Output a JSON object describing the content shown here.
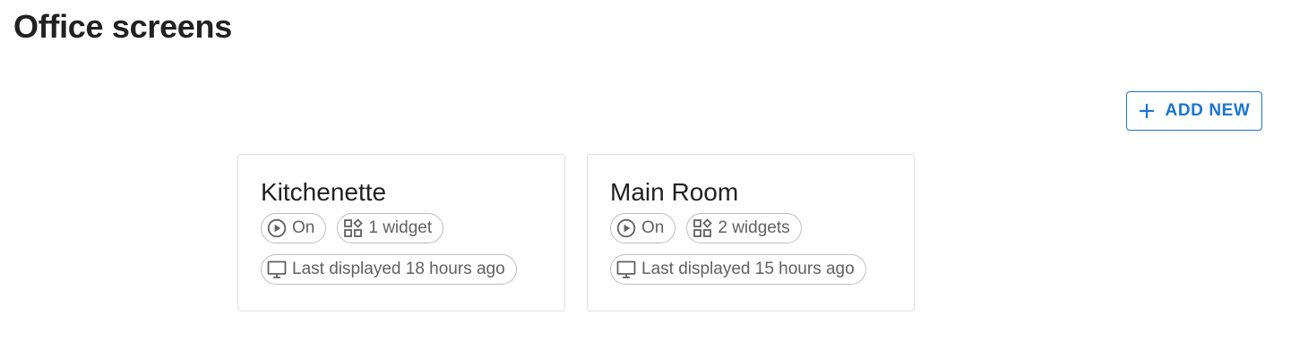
{
  "page": {
    "title": "Office screens"
  },
  "toolbar": {
    "add_new_label": "ADD NEW",
    "add_new_icon": "plus-icon",
    "accent_color": "#1976d2"
  },
  "screens": [
    {
      "name": "Kitchenette",
      "status": "On",
      "status_icon": "play-circle-icon",
      "widgets": "1 widget",
      "widgets_icon": "widgets-icon",
      "last_displayed": "Last displayed 18 hours ago",
      "last_displayed_icon": "monitor-icon"
    },
    {
      "name": "Main Room",
      "status": "On",
      "status_icon": "play-circle-icon",
      "widgets": "2 widgets",
      "widgets_icon": "widgets-icon",
      "last_displayed": "Last displayed 15 hours ago",
      "last_displayed_icon": "monitor-icon"
    }
  ]
}
